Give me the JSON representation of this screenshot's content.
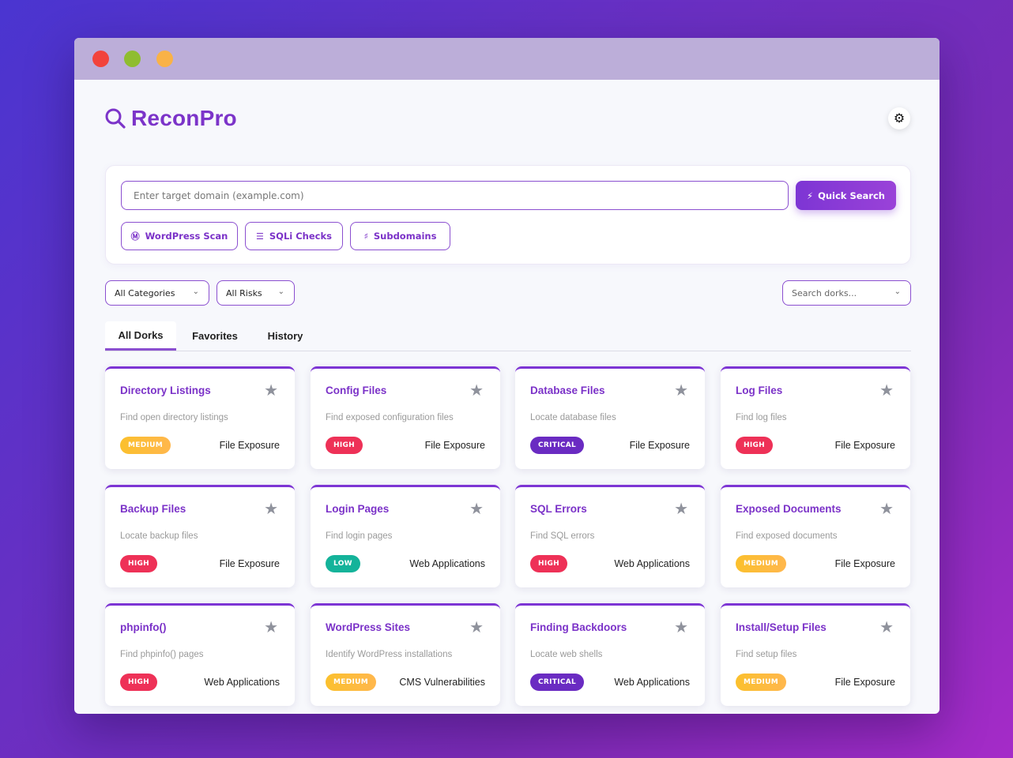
{
  "app": {
    "name": "ReconPro",
    "theme_icon": "gear-icon",
    "accent_color": "#7d35d4"
  },
  "search": {
    "placeholder": "Enter target domain (example.com)",
    "value": "",
    "quick_search_label": "Quick Search",
    "quick_search_icon": "bolt-icon"
  },
  "presets": [
    {
      "label": "WordPress Scan",
      "icon": "wordpress-icon"
    },
    {
      "label": "SQLi Checks",
      "icon": "database-icon"
    },
    {
      "label": "Subdomains",
      "icon": "sitemap-icon"
    }
  ],
  "filters": {
    "category": "All Categories",
    "risk": "All Risks",
    "search_placeholder": "Search dorks..."
  },
  "tabs": [
    {
      "label": "All Dorks",
      "active": true
    },
    {
      "label": "Favorites",
      "active": false
    },
    {
      "label": "History",
      "active": false
    }
  ],
  "cards": [
    {
      "title": "Directory Listings",
      "desc": "Find open directory listings",
      "risk": "MEDIUM",
      "category": "File Exposure"
    },
    {
      "title": "Config Files",
      "desc": "Find exposed configuration files",
      "risk": "HIGH",
      "category": "File Exposure"
    },
    {
      "title": "Database Files",
      "desc": "Locate database files",
      "risk": "CRITICAL",
      "category": "File Exposure"
    },
    {
      "title": "Log Files",
      "desc": "Find log files",
      "risk": "HIGH",
      "category": "File Exposure"
    },
    {
      "title": "Backup Files",
      "desc": "Locate backup files",
      "risk": "HIGH",
      "category": "File Exposure"
    },
    {
      "title": "Login Pages",
      "desc": "Find login pages",
      "risk": "LOW",
      "category": "Web Applications"
    },
    {
      "title": "SQL Errors",
      "desc": "Find SQL errors",
      "risk": "HIGH",
      "category": "Web Applications"
    },
    {
      "title": "Exposed Documents",
      "desc": "Find exposed documents",
      "risk": "MEDIUM",
      "category": "File Exposure"
    },
    {
      "title": "phpinfo()",
      "desc": "Find phpinfo() pages",
      "risk": "HIGH",
      "category": "Web Applications"
    },
    {
      "title": "WordPress Sites",
      "desc": "Identify WordPress installations",
      "risk": "MEDIUM",
      "category": "CMS Vulnerabilities"
    },
    {
      "title": "Finding Backdoors",
      "desc": "Locate web shells",
      "risk": "CRITICAL",
      "category": "Web Applications"
    },
    {
      "title": "Install/Setup Files",
      "desc": "Find setup files",
      "risk": "MEDIUM",
      "category": "File Exposure"
    }
  ],
  "colors": {
    "medium": "#fbc02d",
    "high": "#ee3157",
    "critical": "#6a2bc2",
    "low": "#14b39a"
  }
}
